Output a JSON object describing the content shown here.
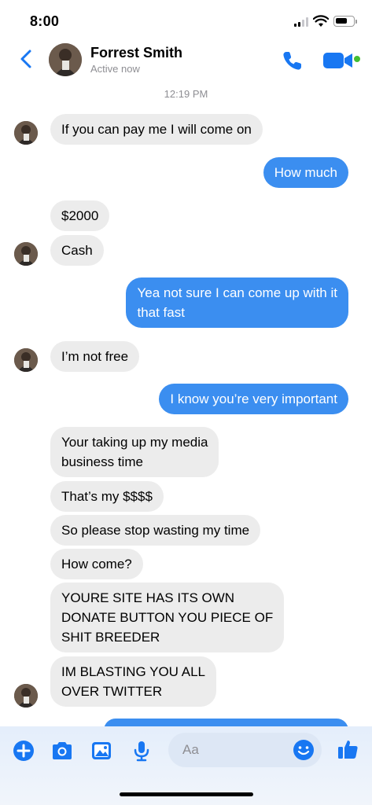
{
  "status_bar": {
    "time": "8:00",
    "battery_level": 0.7
  },
  "header": {
    "contact_name": "Forrest Smith",
    "contact_status": "Active now",
    "icons": [
      "back-chevron-icon",
      "phone-icon",
      "video-camera-icon"
    ],
    "accent_color": "#1877f2",
    "active_color": "#44bd32"
  },
  "conversation": {
    "timestamp": "12:19 PM",
    "messages": [
      {
        "from": "Forrest Smith",
        "text": "If you can pay me I will come on"
      },
      {
        "from": "me",
        "text": "How much"
      },
      {
        "from": "Forrest Smith",
        "text": "$2000"
      },
      {
        "from": "Forrest Smith",
        "text": "Cash"
      },
      {
        "from": "me",
        "lines": [
          "Yea not sure I can come up with it",
          "that fast"
        ]
      },
      {
        "from": "Forrest Smith",
        "text": "I’m not free"
      },
      {
        "from": "me",
        "text": "I know you’re very important"
      },
      {
        "from": "Forrest Smith",
        "lines": [
          "Your taking up my media",
          "business time"
        ]
      },
      {
        "from": "Forrest Smith",
        "text": "That’s my $$$$"
      },
      {
        "from": "Forrest Smith",
        "text": "So please stop wasting my time"
      },
      {
        "from": "Forrest Smith",
        "text": "How come?"
      },
      {
        "from": "Forrest Smith",
        "lines": [
          "YOURE SITE HAS ITS OWN",
          "DONATE BUTTON YOU PIECE OF",
          "SHIT BREEDER"
        ]
      },
      {
        "from": "Forrest Smith",
        "lines": [
          "IM BLASTING YOU ALL",
          "OVER TWITTER"
        ]
      }
    ],
    "incoming_bubble_color": "#ececec",
    "outgoing_bubble_color": "#3b8ef0"
  },
  "composer": {
    "placeholder": "Aa",
    "icons": [
      "plus-icon",
      "camera-icon",
      "photo-icon",
      "microphone-icon",
      "emoji-icon",
      "thumbs-up-icon"
    ]
  }
}
